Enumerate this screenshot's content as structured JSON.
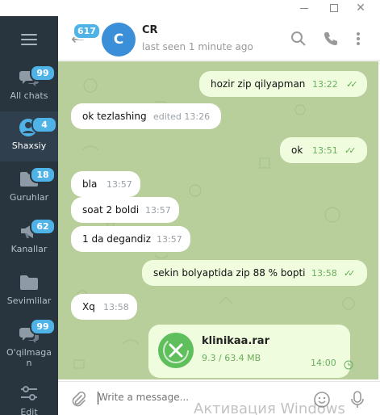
{
  "window": {
    "minimize_icon": "minimize-icon",
    "maximize_icon": "maximize-icon",
    "close_label": "✕"
  },
  "sidebar": {
    "items": [
      {
        "label": "All chats",
        "badge": "99",
        "icon": "chats-icon"
      },
      {
        "label": "Shaxsiy",
        "badge": "4",
        "icon": "person-icon",
        "active": true
      },
      {
        "label": "Guruhlar",
        "badge": "18",
        "icon": "folder-icon"
      },
      {
        "label": "Kanallar",
        "badge": "62",
        "icon": "megaphone-icon"
      },
      {
        "label": "Sevimlilar",
        "badge": "",
        "icon": "folder-icon"
      },
      {
        "label": "O'qilmagan",
        "badge": "99",
        "icon": "chats-icon"
      },
      {
        "label": "Edit",
        "badge": "",
        "icon": "sliders-icon"
      }
    ]
  },
  "header": {
    "unread_badge": "617",
    "avatar_letter": "C",
    "name": "CR",
    "status": "last seen 1 minute ago"
  },
  "messages": [
    {
      "dir": "out",
      "text": "hozir zip qilyapman",
      "time": "13:22",
      "read": true
    },
    {
      "dir": "in",
      "text": "ok tezlashing",
      "time": "edited 13:26"
    },
    {
      "dir": "out",
      "text": "ok",
      "time": "13:51",
      "read": true
    },
    {
      "dir": "in",
      "text": "bla",
      "time": "13:57"
    },
    {
      "dir": "in",
      "text": "soat 2 boldi",
      "time": "13:57"
    },
    {
      "dir": "in",
      "text": "1 da degandiz",
      "time": "13:57"
    },
    {
      "dir": "out",
      "text": "sekin bolyaptida zip 88 % bopti",
      "time": "13:58",
      "read": true
    },
    {
      "dir": "in",
      "text": "Xq",
      "time": "13:58"
    }
  ],
  "file_message": {
    "name": "klinikaa.rar",
    "size": "9.3 / 63.4 MB",
    "time": "14:00"
  },
  "compose": {
    "placeholder": "Write a message..."
  },
  "watermark": "Активация Windows",
  "colors": {
    "sidebar_bg": "#28353f",
    "badge": "#4fb3e8",
    "chat_bg": "#b8cf9b",
    "out_bubble": "#effdde",
    "accent_green": "#5fbf5c"
  }
}
